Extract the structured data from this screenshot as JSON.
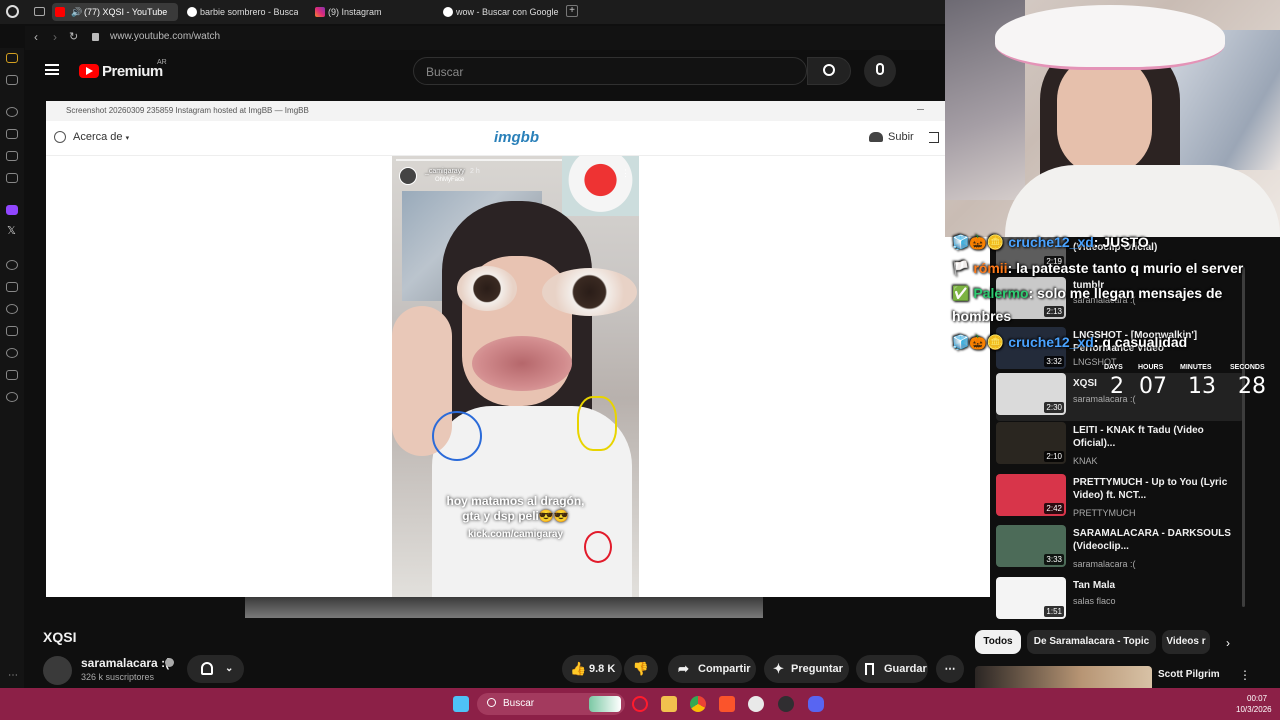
{
  "tabs": [
    {
      "label": "(77) XQSI - YouTube"
    },
    {
      "label": "barbie sombrero - Buscar"
    },
    {
      "label": "(9) Instagram"
    },
    {
      "label": "wow - Buscar con Google"
    }
  ],
  "address": {
    "url": "www.youtube.com/watch"
  },
  "youtube": {
    "logo": "Premium",
    "country": "AR",
    "search_placeholder": "Buscar",
    "video_title": "XQSI",
    "channel": "saramalacara :(",
    "subscribers": "326 k suscriptores",
    "likes": "9.8 K",
    "share": "Compartir",
    "ask": "Preguntar",
    "save": "Guardar"
  },
  "imgbb": {
    "window_title": "Screenshot 20260309 235859 Instagram hosted at ImgBB — ImgBB",
    "about": "Acerca de",
    "logo": "imgbb",
    "upload": "Subir",
    "story_user": "_camigarayy",
    "story_time": "2 h",
    "story_tag": "OhMyFace",
    "caption_line1": "hoy matamos al dragón,",
    "caption_line2": "gta y dsp peli😎😎",
    "caption_link": "kick.com/camigaray"
  },
  "chat": [
    {
      "user": "cruche12_xd",
      "message": ": JUSTO",
      "user_color": "#4aa3ff"
    },
    {
      "user": "rómii",
      "message": ": la pateaste tanto q murio el server",
      "user_color": "#ff7a1a"
    },
    {
      "user": "Palermo",
      "message": ": solo me llegan mensajes de",
      "message2": "hombres",
      "user_color": "#2ecc71"
    },
    {
      "user": "cruche12_xd",
      "message": ": q casualidad",
      "user_color": "#4aa3ff"
    }
  ],
  "timer": {
    "days_label": "DAYS",
    "days": "2",
    "hours_label": "HOURS",
    "hours": "07",
    "minutes_label": "MINUTES",
    "minutes": "13",
    "seconds_label": "SECONDS",
    "seconds": "28"
  },
  "related": [
    {
      "title": "(Videoclip Oficial)",
      "channel": "",
      "duration": "2:19"
    },
    {
      "title": "tumblr",
      "channel": "saramalacara :(",
      "duration": "2:13"
    },
    {
      "title": "LNGSHOT - [Moonwalkin'] Performance Video",
      "channel": "LNGSHOT",
      "duration": "3:32"
    },
    {
      "title": "XQSI",
      "channel": "saramalacara :(",
      "duration": "2:30"
    },
    {
      "title": "LEITI - KNAK ft Tadu (Video Oficial)...",
      "channel": "KNAK",
      "duration": "2:10"
    },
    {
      "title": "PRETTYMUCH - Up to You (Lyric Video) ft. NCT...",
      "channel": "PRETTYMUCH",
      "duration": "2:42"
    },
    {
      "title": "SARAMALACARA - DARKSOULS (Videoclip...",
      "channel": "saramalacara :(",
      "duration": "3:33"
    },
    {
      "title": "Tan Mala",
      "channel": "salas flaco",
      "duration": "1:51"
    }
  ],
  "chips": [
    "Todos",
    "De Saramalacara - Topic",
    "Videos r"
  ],
  "next_video": {
    "title": "Scott Pilgrim"
  },
  "taskbar": {
    "search": "Buscar",
    "time": "00:07",
    "date": "10/3/2026"
  },
  "colors": {
    "youtube_red": "#ff0000",
    "imgbb_blue": "#2a80b9",
    "taskbar": "#8c2047"
  }
}
